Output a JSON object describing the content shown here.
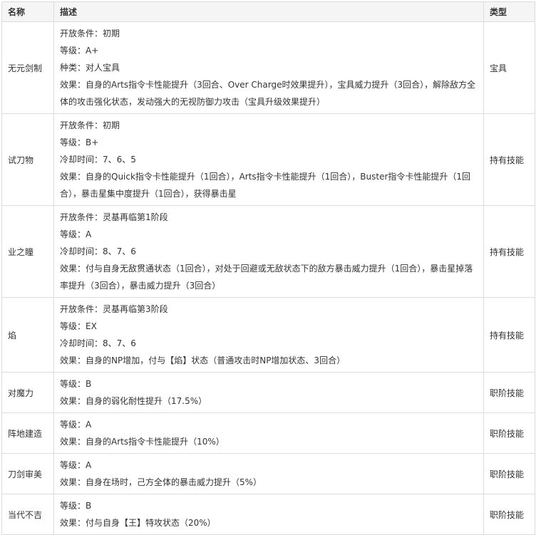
{
  "headers": {
    "name": "名称",
    "desc": "描述",
    "type": "类型"
  },
  "rows": [
    {
      "name": "无元剑制",
      "type": "宝具",
      "lines": [
        "开放条件：初期",
        "等级：A+",
        "种类：对人宝具",
        "效果：自身的Arts指令卡性能提升（3回合、Over Charge时效果提升），宝具威力提升（3回合），解除敌方全体的攻击强化状态，发动强大的无视防御力攻击（宝具升级效果提升）"
      ]
    },
    {
      "name": "试刀物",
      "type": "持有技能",
      "lines": [
        "开放条件：初期",
        "等级：B+",
        "冷却时间：7、6、5",
        "效果：自身的Quick指令卡性能提升（1回合），Arts指令卡性能提升（1回合），Buster指令卡性能提升（1回合），暴击星集中度提升（1回合），获得暴击星"
      ]
    },
    {
      "name": "业之瞳",
      "type": "持有技能",
      "lines": [
        "开放条件：灵基再临第1阶段",
        "等级：A",
        "冷却时间：8、7、6",
        "效果：付与自身无敌贯通状态（1回合），对处于回避或无敌状态下的敌方暴击威力提升（1回合），暴击星掉落率提升（3回合），暴击威力提升（3回合）"
      ]
    },
    {
      "name": "焰",
      "type": "持有技能",
      "lines": [
        "开放条件：灵基再临第3阶段",
        "等级：EX",
        "冷却时间：8、7、6",
        "效果：自身的NP增加，付与【焰】状态（普通攻击时NP增加状态、3回合）"
      ]
    },
    {
      "name": "对魔力",
      "type": "职阶技能",
      "lines": [
        "等级：B",
        "效果：自身的弱化耐性提升（17.5%）"
      ]
    },
    {
      "name": "阵地建造",
      "type": "职阶技能",
      "lines": [
        "等级：A",
        "效果：自身的Arts指令卡性能提升（10%）"
      ]
    },
    {
      "name": "刀剑审美",
      "type": "职阶技能",
      "lines": [
        "等级：A",
        "效果：自身在场时，己方全体的暴击威力提升（5%）"
      ]
    },
    {
      "name": "当代不吉",
      "type": "职阶技能",
      "lines": [
        "等级：B",
        "效果：付与自身【王】特攻状态（20%）"
      ]
    }
  ]
}
